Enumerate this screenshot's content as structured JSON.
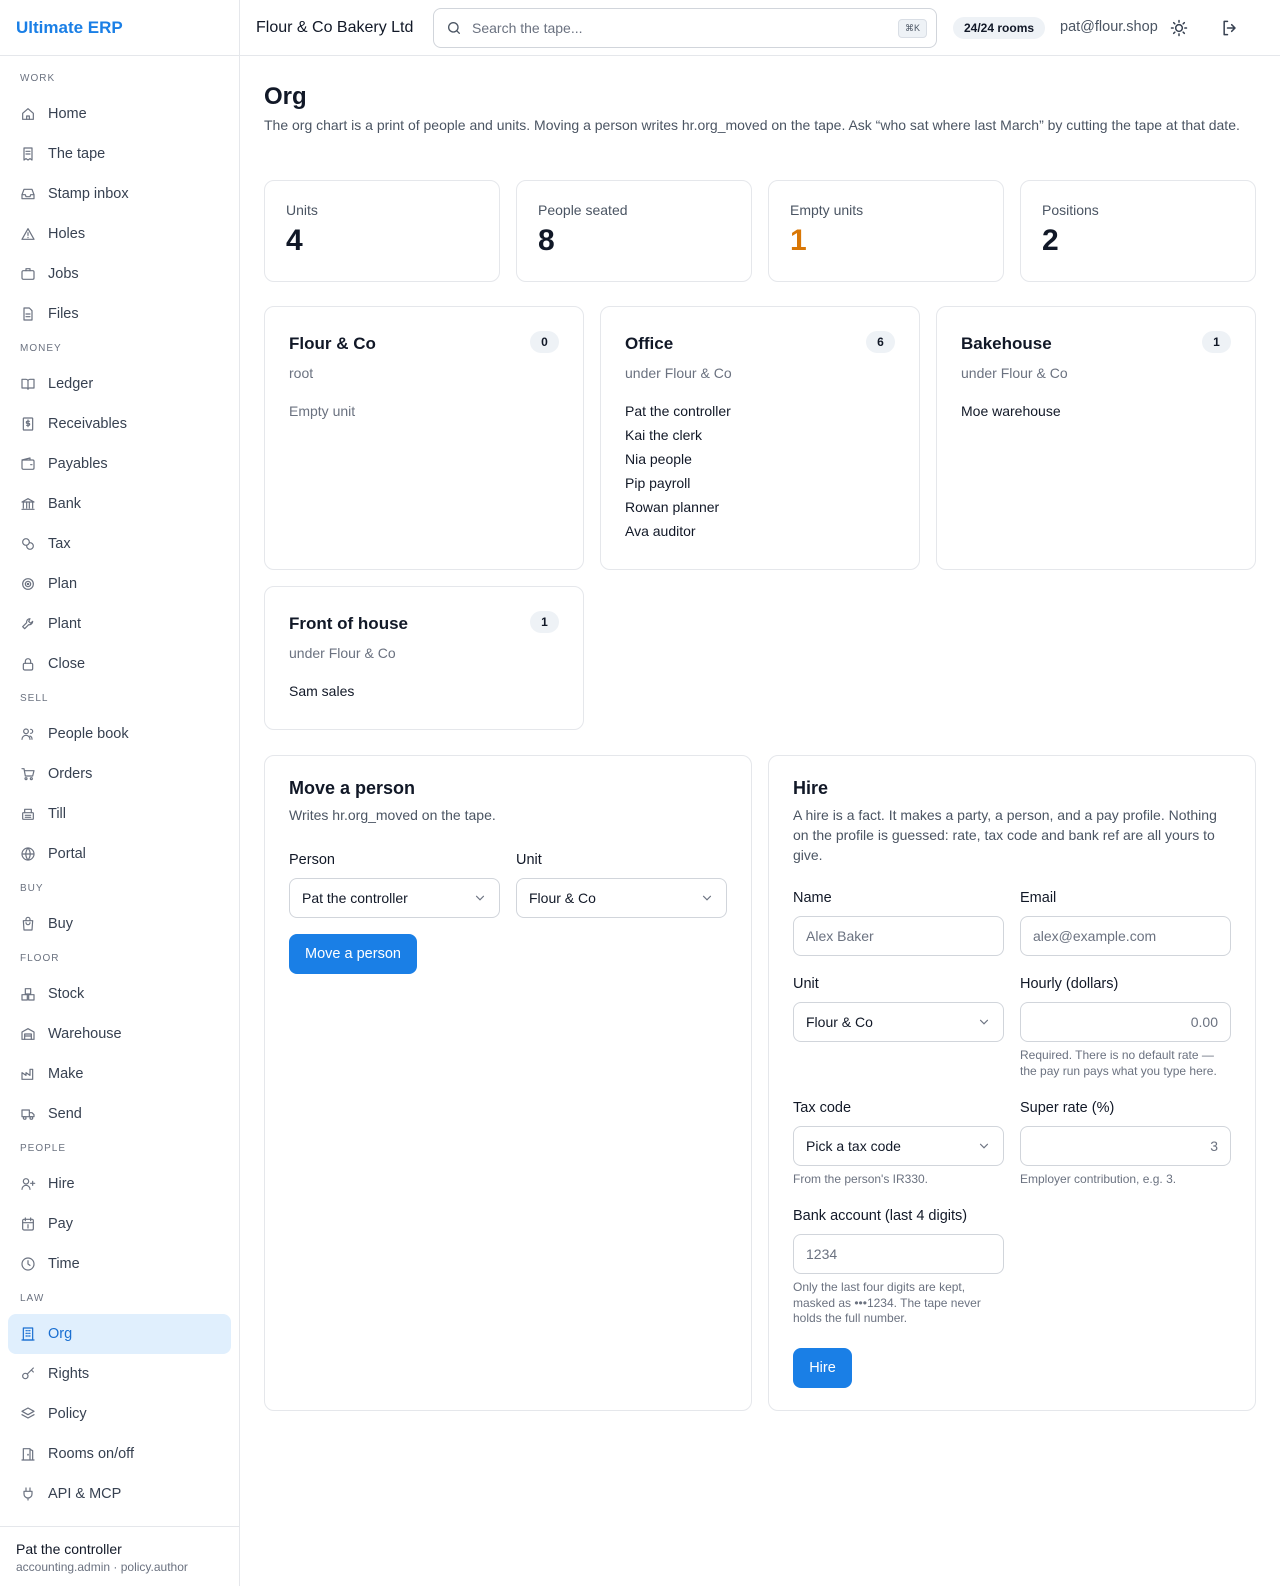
{
  "app": {
    "brand": "Ultimate ERP",
    "company": "Flour & Co Bakery Ltd"
  },
  "topbar": {
    "search_placeholder": "Search the tape...",
    "shortcut": "⌘K",
    "rooms_badge": "24/24 rooms",
    "user_email": "pat@flour.shop"
  },
  "sidebar": {
    "sections": [
      {
        "title": "WORK",
        "items": [
          {
            "label": "Home",
            "icon": "home-icon"
          },
          {
            "label": "The tape",
            "icon": "receipt-icon"
          },
          {
            "label": "Stamp inbox",
            "icon": "inbox-icon"
          },
          {
            "label": "Holes",
            "icon": "warning-triangle-icon"
          },
          {
            "label": "Jobs",
            "icon": "briefcase-icon"
          },
          {
            "label": "Files",
            "icon": "file-icon"
          }
        ]
      },
      {
        "title": "MONEY",
        "items": [
          {
            "label": "Ledger",
            "icon": "book-open-icon"
          },
          {
            "label": "Receivables",
            "icon": "dollar-receipt-icon"
          },
          {
            "label": "Payables",
            "icon": "wallet-icon"
          },
          {
            "label": "Bank",
            "icon": "bank-icon"
          },
          {
            "label": "Tax",
            "icon": "coins-icon"
          },
          {
            "label": "Plan",
            "icon": "target-icon"
          },
          {
            "label": "Plant",
            "icon": "wrench-icon"
          },
          {
            "label": "Close",
            "icon": "lock-icon"
          }
        ]
      },
      {
        "title": "SELL",
        "items": [
          {
            "label": "People book",
            "icon": "users-icon"
          },
          {
            "label": "Orders",
            "icon": "cart-icon"
          },
          {
            "label": "Till",
            "icon": "cash-register-icon"
          },
          {
            "label": "Portal",
            "icon": "globe-icon"
          }
        ]
      },
      {
        "title": "BUY",
        "items": [
          {
            "label": "Buy",
            "icon": "shopping-bag-icon"
          }
        ]
      },
      {
        "title": "FLOOR",
        "items": [
          {
            "label": "Stock",
            "icon": "boxes-icon"
          },
          {
            "label": "Warehouse",
            "icon": "warehouse-icon"
          },
          {
            "label": "Make",
            "icon": "factory-icon"
          },
          {
            "label": "Send",
            "icon": "truck-icon"
          }
        ]
      },
      {
        "title": "PEOPLE",
        "items": [
          {
            "label": "Hire",
            "icon": "user-plus-icon"
          },
          {
            "label": "Pay",
            "icon": "calendar-dollar-icon"
          },
          {
            "label": "Time",
            "icon": "clock-icon"
          }
        ]
      },
      {
        "title": "LAW",
        "items": [
          {
            "label": "Org",
            "icon": "building-icon",
            "active": true
          },
          {
            "label": "Rights",
            "icon": "key-icon"
          },
          {
            "label": "Policy",
            "icon": "layers-icon"
          },
          {
            "label": "Rooms on/off",
            "icon": "door-icon"
          },
          {
            "label": "API & MCP",
            "icon": "plug-icon"
          }
        ]
      }
    ],
    "user": {
      "name": "Pat the controller",
      "roles": "accounting.admin · policy.author"
    }
  },
  "page": {
    "title": "Org",
    "description": "The org chart is a print of people and units. Moving a person writes hr.org_moved on the tape. Ask “who sat where last March” by cutting the tape at that date."
  },
  "stats": [
    {
      "label": "Units",
      "value": "4"
    },
    {
      "label": "People seated",
      "value": "8"
    },
    {
      "label": "Empty units",
      "value": "1",
      "color": "#d97706"
    },
    {
      "label": "Positions",
      "value": "2"
    }
  ],
  "units": [
    {
      "name": "Flour & Co",
      "parent": "root",
      "count": "0",
      "people": [],
      "empty_text": "Empty unit"
    },
    {
      "name": "Office",
      "parent": "under Flour & Co",
      "count": "6",
      "people": [
        "Pat the controller",
        "Kai the clerk",
        "Nia people",
        "Pip payroll",
        "Rowan planner",
        "Ava auditor"
      ]
    },
    {
      "name": "Bakehouse",
      "parent": "under Flour & Co",
      "count": "1",
      "people": [
        "Moe warehouse"
      ]
    },
    {
      "name": "Front of house",
      "parent": "under Flour & Co",
      "count": "1",
      "people": [
        "Sam sales"
      ]
    }
  ],
  "move": {
    "title": "Move a person",
    "desc": "Writes hr.org_moved on the tape.",
    "person_label": "Person",
    "person_value": "Pat the controller",
    "unit_label": "Unit",
    "unit_value": "Flour & Co",
    "button": "Move a person"
  },
  "hire": {
    "title": "Hire",
    "desc": "A hire is a fact. It makes a party, a person, and a pay profile. Nothing on the profile is guessed: rate, tax code and bank ref are all yours to give.",
    "name_label": "Name",
    "name_placeholder": "Alex Baker",
    "email_label": "Email",
    "email_placeholder": "alex@example.com",
    "unit_label": "Unit",
    "unit_value": "Flour & Co",
    "hourly_label": "Hourly (dollars)",
    "hourly_placeholder": "0.00",
    "hourly_hint": "Required. There is no default rate — the pay run pays what you type here.",
    "tax_label": "Tax code",
    "tax_value": "Pick a tax code",
    "tax_hint": "From the person's IR330.",
    "super_label": "Super rate (%)",
    "super_value": "3",
    "super_hint": "Employer contribution, e.g. 3.",
    "bank_label": "Bank account (last 4 digits)",
    "bank_placeholder": "1234",
    "bank_hint": "Only the last four digits are kept, masked as •••1234. The tape never holds the full number.",
    "button": "Hire"
  },
  "colors": {
    "accent": "#1a7fe6",
    "warning": "#d97706",
    "active_bg": "#e0effd"
  }
}
